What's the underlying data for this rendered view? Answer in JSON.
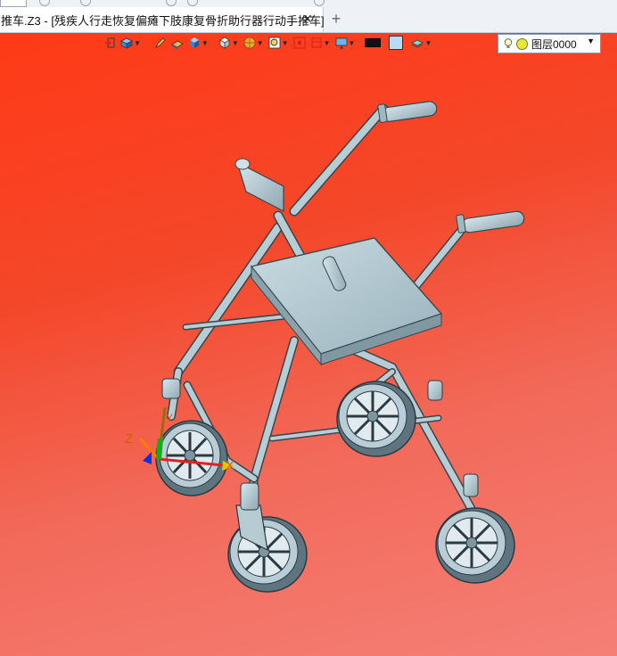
{
  "tab": {
    "title": "推车.Z3 - [残疾人行走恢复偏瘫下肢康复骨折助行器行动手推车]",
    "close_glyph": "✕",
    "add_glyph": "+"
  },
  "toolbar": {
    "layer_value": "图层0000",
    "colors": {
      "line_color": "#111111",
      "fill_color": "#b8dcf5"
    }
  },
  "triad": {
    "x_label": "X",
    "y_label": "Y",
    "z_label": "Z"
  },
  "viewport": {
    "background_colors": [
      "#ff3a16",
      "#f57f76"
    ]
  }
}
